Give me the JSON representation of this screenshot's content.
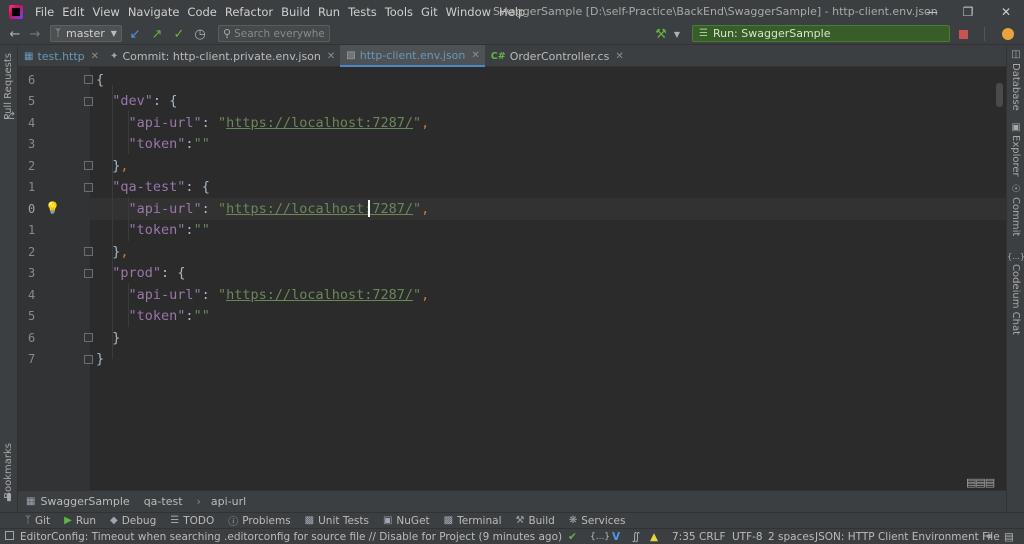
{
  "window": {
    "title": "SwaggerSample [D:\\self-Practice\\BackEnd\\SwaggerSample] - http-client.env.json"
  },
  "menu": [
    "File",
    "Edit",
    "View",
    "Navigate",
    "Code",
    "Refactor",
    "Build",
    "Run",
    "Tests",
    "Tools",
    "Git",
    "Window",
    "Help"
  ],
  "toolbar": {
    "branch": "master",
    "search_placeholder": "Search everywhere",
    "run_config": "Run: SwaggerSample"
  },
  "left_stripe": {
    "top": "Pull Requests",
    "bottom": "Bookmarks"
  },
  "right_stripe": [
    "Database",
    "Explorer",
    "Commit",
    "Codeium Chat"
  ],
  "tabs": [
    {
      "label": "test.http",
      "icon": "http-file-icon"
    },
    {
      "label": "Commit: http-client.private.env.json",
      "icon": "commit-icon"
    },
    {
      "label": "http-client.env.json",
      "icon": "json-file-icon",
      "active": true
    },
    {
      "label": "OrderController.cs",
      "icon": "csharp-file-icon",
      "prefix": "C#"
    }
  ],
  "editor": {
    "line_numbers": [
      "6",
      "5",
      "4",
      "3",
      "2",
      "1",
      "0",
      "1",
      "2",
      "3",
      "4",
      "5",
      "6",
      "7"
    ],
    "current_line_index": 6,
    "lines": [
      "{",
      "  \"dev\": {",
      "    \"api-url\": \"https://localhost:7287/\",",
      "    \"token\":\"\"",
      "  },",
      "  \"qa-test\": {",
      "    \"api-url\": \"https://localhost:7287/\",",
      "    \"token\":\"\"",
      "  },",
      "  \"prod\": {",
      "    \"api-url\": \"https://localhost:7287/\",",
      "    \"token\":\"\"",
      "  }",
      "}"
    ]
  },
  "breadcrumb": [
    "SwaggerSample",
    "qa-test",
    "api-url"
  ],
  "tool_windows": [
    {
      "label": "Git",
      "icon": "git-icon"
    },
    {
      "label": "Run",
      "icon": "run-icon"
    },
    {
      "label": "Debug",
      "icon": "debug-icon"
    },
    {
      "label": "TODO",
      "icon": "todo-icon"
    },
    {
      "label": "Problems",
      "icon": "problems-icon"
    },
    {
      "label": "Unit Tests",
      "icon": "unit-tests-icon"
    },
    {
      "label": "NuGet",
      "icon": "nuget-icon"
    },
    {
      "label": "Terminal",
      "icon": "terminal-icon"
    },
    {
      "label": "Build",
      "icon": "build-icon"
    },
    {
      "label": "Services",
      "icon": "services-icon"
    }
  ],
  "status": {
    "message": "EditorConfig: Timeout when searching .editorconfig for source file // Disable for Project (9 minutes ago)",
    "position": "7:35",
    "line_ending": "CRLF",
    "encoding": "UTF-8",
    "indent": "2 spaces",
    "file_type": "JSON: HTTP Client Environment File"
  },
  "colors": {
    "accent": "#4a88c7",
    "run_green": "#375d28",
    "string": "#6a8759",
    "key": "#9876aa"
  }
}
